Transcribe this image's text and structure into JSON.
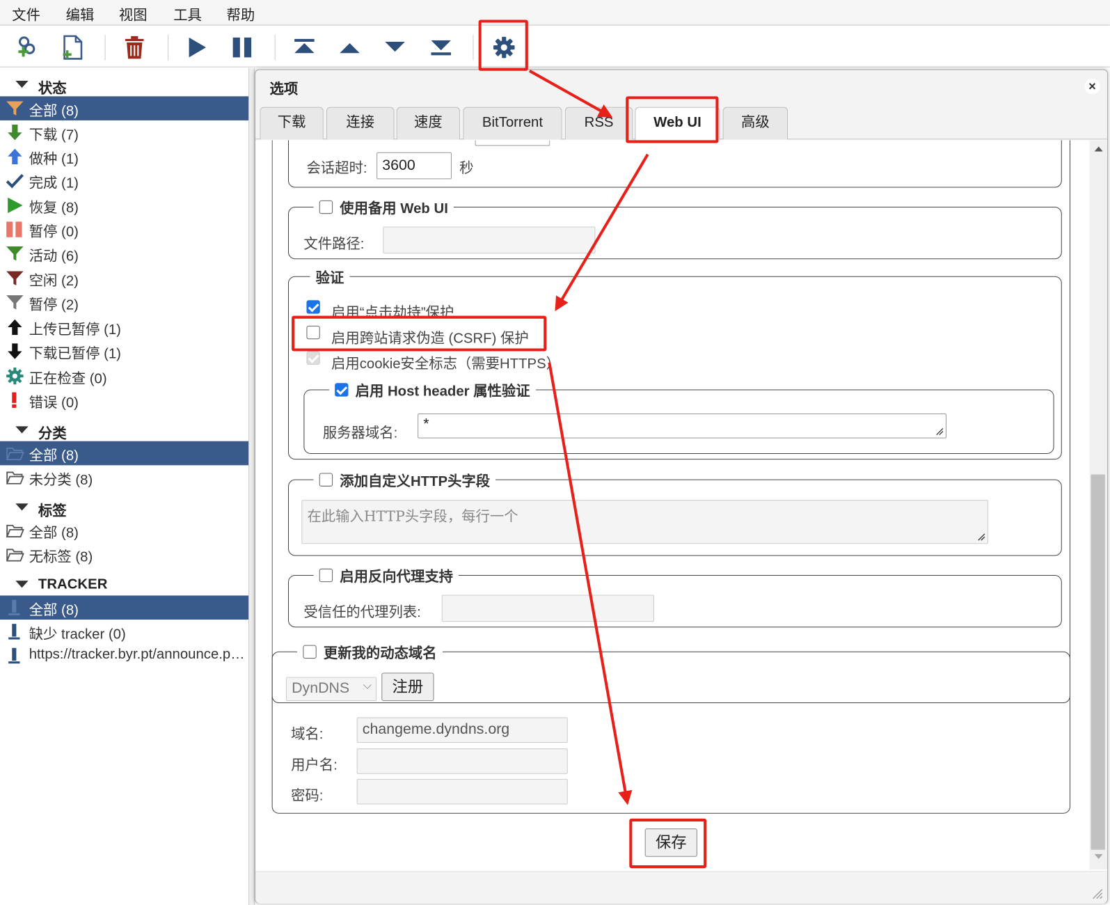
{
  "menu": [
    "文件",
    "编辑",
    "视图",
    "工具",
    "帮助"
  ],
  "toolbar": {
    "icons": [
      "add-link-icon",
      "add-file-icon",
      "delete-icon",
      "resume-icon",
      "pause-icon",
      "move-top-icon",
      "move-up-icon",
      "move-down-icon",
      "move-bottom-icon",
      "options-gear-icon"
    ]
  },
  "sidebar": {
    "status_title": "状态",
    "status_items": [
      {
        "label": "全部 (8)",
        "icon": "filter-all-icon",
        "selected": true
      },
      {
        "label": "下载 (7)",
        "icon": "download-arrow-icon"
      },
      {
        "label": "做种 (1)",
        "icon": "upload-arrow-icon"
      },
      {
        "label": "完成 (1)",
        "icon": "checkmark-icon"
      },
      {
        "label": "恢复 (8)",
        "icon": "play-icon"
      },
      {
        "label": "暂停 (0)",
        "icon": "pause-icon"
      },
      {
        "label": "活动 (6)",
        "icon": "filter-active-icon"
      },
      {
        "label": "空闲 (2)",
        "icon": "filter-inactive-icon"
      },
      {
        "label": "暂停 (2)",
        "icon": "filter-stalled-icon"
      },
      {
        "label": "上传已暂停 (1)",
        "icon": "upload-paused-icon"
      },
      {
        "label": "下载已暂停 (1)",
        "icon": "download-paused-icon"
      },
      {
        "label": "正在检查 (0)",
        "icon": "checking-gear-icon"
      },
      {
        "label": "错误 (0)",
        "icon": "error-icon"
      }
    ],
    "category_title": "分类",
    "category_items": [
      {
        "label": "全部 (8)",
        "selected": true
      },
      {
        "label": "未分类 (8)"
      }
    ],
    "tags_title": "标签",
    "tags_items": [
      {
        "label": "全部 (8)"
      },
      {
        "label": "无标签 (8)"
      }
    ],
    "tracker_title": "TRACKER",
    "tracker_items": [
      {
        "label": "全部 (8)",
        "selected": true
      },
      {
        "label": "缺少 tracker (0)"
      },
      {
        "label": "https://tracker.byr.pt/announce.php"
      }
    ]
  },
  "dialog": {
    "title": "选项",
    "close": "×",
    "tabs": [
      "下载",
      "连接",
      "速度",
      "BitTorrent",
      "RSS",
      "Web UI",
      "高级"
    ],
    "active_tab": "Web UI",
    "session_timeout_label": "会话超时:",
    "session_timeout_value": "3600",
    "session_timeout_unit": "秒",
    "alt_webui": {
      "label": "使用备用 Web UI",
      "checked": false,
      "path_label": "文件路径:",
      "path_value": ""
    },
    "security": {
      "legend": "验证",
      "clickjacking": {
        "label": "启用“点击劫持”保护",
        "checked": true
      },
      "csrf": {
        "label": "启用跨站请求伪造 (CSRF) 保护",
        "checked": false
      },
      "cookie": {
        "label": "启用cookie安全标志（需要HTTPS）",
        "checked": true,
        "disabled": true
      },
      "host_header": {
        "label": "启用 Host header 属性验证",
        "checked": true,
        "domains_label": "服务器域名:",
        "domains_value": "*"
      }
    },
    "custom_headers": {
      "label": "添加自定义HTTP头字段",
      "checked": false,
      "placeholder": "在此输入HTTP头字段，每行一个"
    },
    "reverse_proxy": {
      "label": "启用反向代理支持",
      "checked": false,
      "trusted_label": "受信任的代理列表:",
      "trusted_value": ""
    },
    "dyndns": {
      "label": "更新我的动态域名",
      "checked": false,
      "service": "DynDNS",
      "register_button": "注册",
      "domain_label": "域名:",
      "domain_value": "changeme.dyndns.org",
      "username_label": "用户名:",
      "username_value": "",
      "password_label": "密码:",
      "password_value": ""
    },
    "save_button": "保存"
  },
  "annotation_color": "#e8201a"
}
